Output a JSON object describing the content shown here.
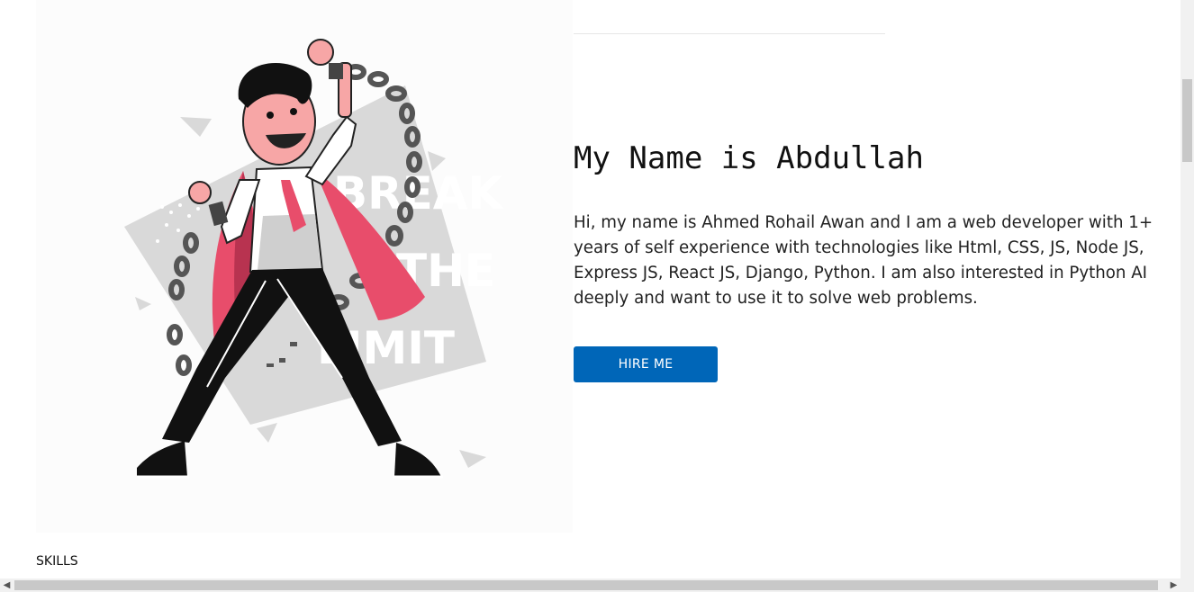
{
  "hero": {
    "title": "My Name is Abdullah",
    "bio": "Hi, my name is Ahmed Rohail Awan and I am a web developer with 1+ years of self experience with technologies like Html, CSS, JS, Node JS, Express JS, React JS, Django, Python. I am also interested in Python AI deeply and want to use it to solve web problems.",
    "hire_label": "HIRE ME",
    "illustration_text": [
      "BREAK",
      "THE",
      "LIMIT"
    ]
  },
  "sections": {
    "skills_label": "SKILLS"
  },
  "colors": {
    "accent": "#0066b8",
    "cape": "#e84d6b",
    "skin": "#f7a6a6"
  },
  "icons": {
    "scroll_left": "chevron-left-icon",
    "scroll_right": "chevron-right-icon"
  }
}
